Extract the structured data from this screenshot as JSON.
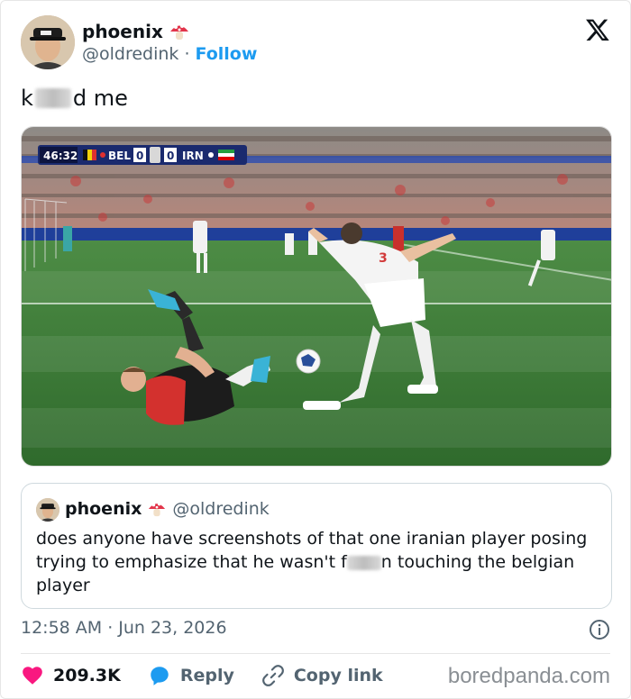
{
  "header": {
    "display_name": "phoenix",
    "handle": "@oldredink",
    "separator": "·",
    "follow_label": "Follow"
  },
  "tweet": {
    "text_start": "k",
    "text_end": "d me"
  },
  "scorebug": {
    "time": "46:32",
    "team_home": "BEL",
    "score_home": "0",
    "score_away": "0",
    "team_away": "IRN"
  },
  "quote": {
    "display_name": "phoenix",
    "handle": "@oldredink",
    "text_part1": "does anyone have screenshots of that one iranian player posing trying to emphasize that he wasn't f",
    "text_part2": "n touching the belgian player"
  },
  "meta": {
    "time": "12:58 AM",
    "separator": "·",
    "date": "Jun 23, 2026"
  },
  "actions": {
    "likes": "209.3K",
    "reply_label": "Reply",
    "copy_label": "Copy link"
  },
  "watermark": "boredpanda.com",
  "colors": {
    "accent": "#1d9bf0",
    "like": "#f91880",
    "pitch": "#3f7d3a"
  }
}
